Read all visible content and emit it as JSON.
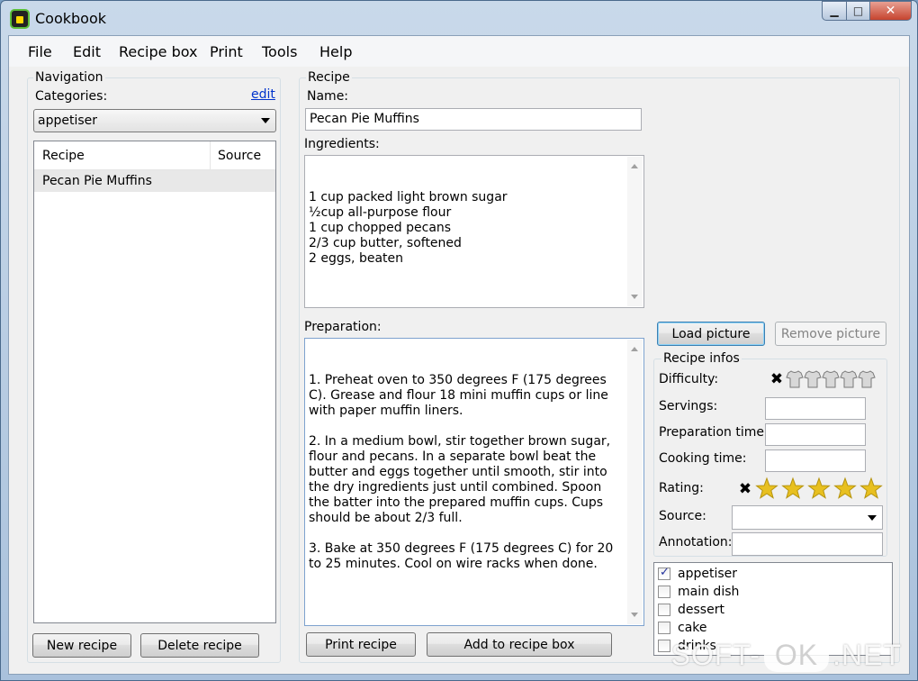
{
  "window": {
    "title": "Cookbook"
  },
  "menu": [
    "File",
    "Edit",
    "Recipe box",
    "Print",
    "Tools",
    "Help"
  ],
  "navigation": {
    "group": "Navigation",
    "categories_label": "Categories:",
    "edit_link": "edit",
    "selected_category": "appetiser",
    "columns": [
      "Recipe",
      "Source"
    ],
    "recipes": [
      "Pecan Pie Muffins"
    ],
    "new_button": "New recipe",
    "delete_button": "Delete recipe"
  },
  "recipe": {
    "group": "Recipe",
    "name_label": "Name:",
    "name": "Pecan Pie Muffins",
    "ingredients_label": "Ingredients:",
    "ingredients": "1 cup packed light brown sugar\n½cup all-purpose flour\n1 cup chopped pecans\n2/3 cup butter, softened\n2 eggs, beaten",
    "preparation_label": "Preparation:",
    "preparation": "1. Preheat oven to 350 degrees F (175 degrees C). Grease and flour 18 mini muffin cups or line with paper muffin liners.\n\n2. In a medium bowl, stir together brown sugar, flour and pecans. In a separate bowl beat the butter and eggs together until smooth, stir into the dry ingredients just until combined. Spoon the batter into the prepared muffin cups. Cups should be about 2/3 full.\n\n3. Bake at 350 degrees F (175 degrees C) for 20 to 25 minutes. Cool on wire racks when done.",
    "print_button": "Print recipe",
    "add_button": "Add to recipe box"
  },
  "picture": {
    "load_button": "Load picture",
    "remove_button": "Remove picture"
  },
  "infos": {
    "group": "Recipe infos",
    "difficulty_label": "Difficulty:",
    "difficulty_value": 0,
    "difficulty_max": 5,
    "servings_label": "Servings:",
    "servings": "",
    "prep_time_label": "Preparation time:",
    "prep_time": "",
    "cook_time_label": "Cooking time:",
    "cook_time": "",
    "rating_label": "Rating:",
    "rating_value": 5,
    "rating_max": 5,
    "source_label": "Source:",
    "source": "",
    "annotation_label": "Annotation:",
    "annotation": ""
  },
  "category_checklist": [
    {
      "label": "appetiser",
      "checked": true
    },
    {
      "label": "main dish",
      "checked": false
    },
    {
      "label": "dessert",
      "checked": false
    },
    {
      "label": "cake",
      "checked": false
    },
    {
      "label": "drinks",
      "checked": false
    }
  ],
  "colors": {
    "link": "#0033cc",
    "star": "#e8c020",
    "shirt": "#a8a8a8"
  },
  "watermark": {
    "left": "SOFT-",
    "middle": "OK",
    "right": ".NET"
  }
}
